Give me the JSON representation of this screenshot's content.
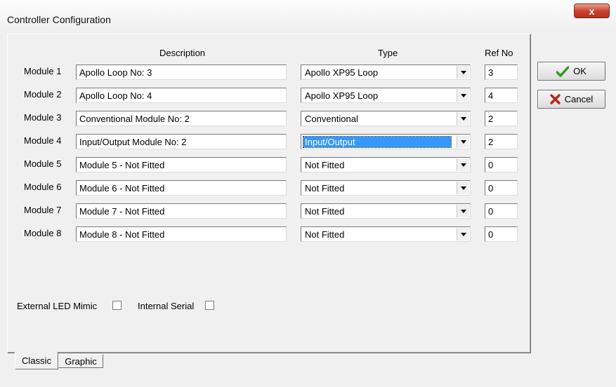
{
  "window": {
    "title": "Controller Configuration",
    "close_glyph": "x"
  },
  "headers": {
    "description": "Description",
    "type": "Type",
    "ref_no": "Ref No"
  },
  "modules": [
    {
      "label": "Module 1",
      "description": "Apollo Loop No: 3",
      "type": "Apollo XP95 Loop",
      "ref": "3",
      "selected": false
    },
    {
      "label": "Module 2",
      "description": "Apollo Loop No: 4",
      "type": "Apollo XP95 Loop",
      "ref": "4",
      "selected": false
    },
    {
      "label": "Module 3",
      "description": "Conventional Module No: 2",
      "type": "Conventional",
      "ref": "2",
      "selected": false
    },
    {
      "label": "Module 4",
      "description": "Input/Output Module No: 2",
      "type": "Input/Output",
      "ref": "2",
      "selected": true
    },
    {
      "label": "Module 5",
      "description": "Module 5 - Not Fitted",
      "type": "Not Fitted",
      "ref": "0",
      "selected": false
    },
    {
      "label": "Module 6",
      "description": "Module 6 - Not Fitted",
      "type": "Not Fitted",
      "ref": "0",
      "selected": false
    },
    {
      "label": "Module 7",
      "description": "Module 7 - Not Fitted",
      "type": "Not Fitted",
      "ref": "0",
      "selected": false
    },
    {
      "label": "Module 8",
      "description": "Module 8 - Not Fitted",
      "type": "Not Fitted",
      "ref": "0",
      "selected": false
    }
  ],
  "options": {
    "external_led_mimic": {
      "label": "External LED Mimic",
      "checked": false
    },
    "internal_serial": {
      "label": "Internal Serial",
      "checked": false
    }
  },
  "tabs": [
    {
      "label": "Classic",
      "active": true
    },
    {
      "label": "Graphic",
      "active": false
    }
  ],
  "buttons": {
    "ok": {
      "label": "OK",
      "icon": "checkmark-icon",
      "color": "#2f9a1e"
    },
    "cancel": {
      "label": "Cancel",
      "icon": "cross-icon",
      "color": "#b3261a"
    }
  }
}
